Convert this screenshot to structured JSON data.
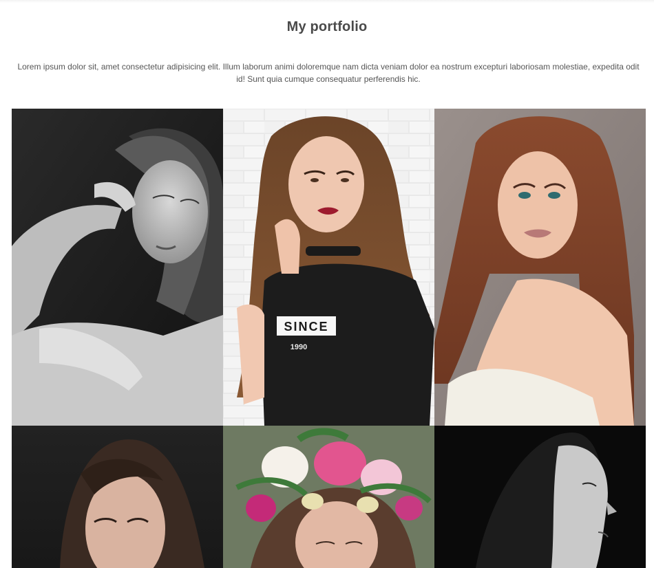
{
  "portfolio": {
    "title": "My portfolio",
    "intro": "Lorem ipsum dolor sit, amet consectetur adipisicing elit. Illum laborum animi doloremque nam dicta veniam dolor ea nostrum excepturi laboriosam molestiae, expedita odit id! Sunt quia cumque consequatur perferendis hic.",
    "photos": [
      {
        "name": "portrait-bw-hand-on-lips",
        "shirt_text": ""
      },
      {
        "name": "portrait-brick-wall-black-tee",
        "shirt_text": "SINCE",
        "shirt_subtext": "1990"
      },
      {
        "name": "portrait-redhead-off-shoulder",
        "shirt_text": ""
      },
      {
        "name": "portrait-dark-background",
        "shirt_text": ""
      },
      {
        "name": "portrait-flower-crown",
        "shirt_text": ""
      },
      {
        "name": "portrait-bw-profile",
        "shirt_text": ""
      }
    ]
  }
}
